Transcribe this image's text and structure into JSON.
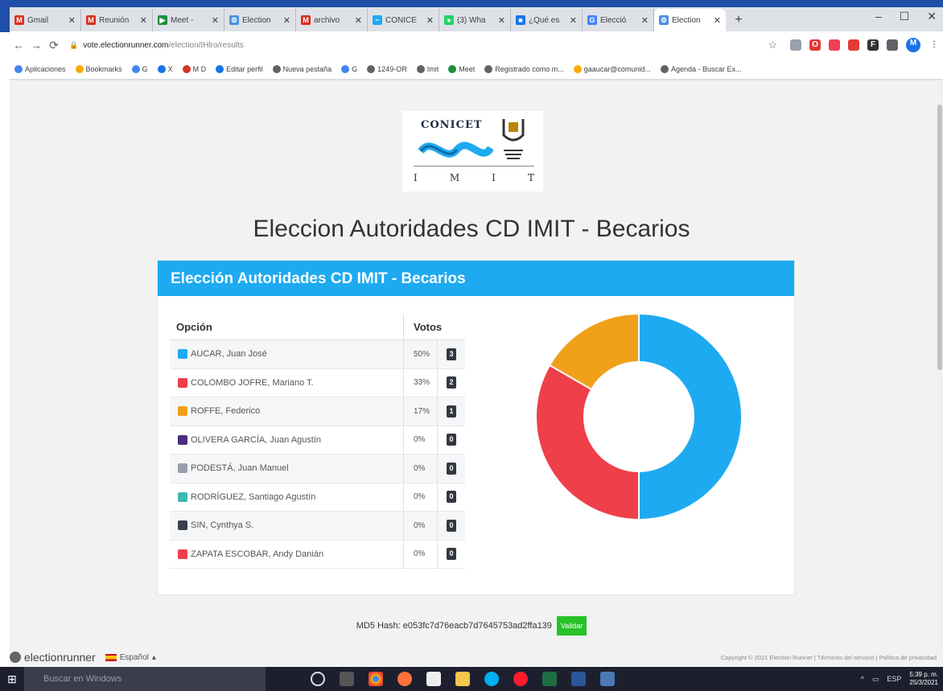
{
  "browser": {
    "tabs": [
      {
        "label": "Gmail",
        "color": "#d93025",
        "glyph": "M"
      },
      {
        "label": "Reunión",
        "color": "#d93025",
        "glyph": "M"
      },
      {
        "label": "Meet -",
        "color": "#1e8e3e",
        "glyph": "▶"
      },
      {
        "label": "Election",
        "color": "#4a90e2",
        "glyph": "⚙"
      },
      {
        "label": "archivo",
        "color": "#d93025",
        "glyph": "M"
      },
      {
        "label": "CONICE",
        "color": "#1eaaf1",
        "glyph": "~"
      },
      {
        "label": "(3) Wha",
        "color": "#25d366",
        "glyph": "●"
      },
      {
        "label": "¿Qué es",
        "color": "#1a73e8",
        "glyph": "■"
      },
      {
        "label": "Elecció",
        "color": "#4285f4",
        "glyph": "G"
      },
      {
        "label": "Election",
        "color": "#4a90e2",
        "glyph": "⚙"
      }
    ],
    "active_tab": 9,
    "url_host": "vote.electionrunner.com",
    "url_path": "/election/IHlro/results",
    "bookmarks": [
      "Aplicaciones",
      "Bookmarks",
      "G",
      "X",
      "M D",
      "Editar perfil",
      "Nueva pestaña",
      "G",
      "1249-OR",
      "Imit",
      "Meet",
      "Registrado como m...",
      "gaaucar@comunid...",
      "Agenda - Buscar Ex..."
    ]
  },
  "logo": {
    "top_text": "CONICET",
    "bottom_letters": [
      "I",
      "M",
      "I",
      "T"
    ]
  },
  "page_title": "Eleccion Autoridades CD IMIT - Becarios",
  "card": {
    "header": "Elección Autoridades CD IMIT - Becarios",
    "col_option": "Opción",
    "col_votes": "Votos",
    "rows": [
      {
        "name": "AUCAR, Juan José",
        "pct": "50%",
        "votes": "3",
        "color": "#1eaaf1"
      },
      {
        "name": "COLOMBO JOFRE, Mariano T.",
        "pct": "33%",
        "votes": "2",
        "color": "#ef3f4a"
      },
      {
        "name": "ROFFE, Federico",
        "pct": "17%",
        "votes": "1",
        "color": "#f0a019"
      },
      {
        "name": "OLIVERA GARCÍA, Juan Agustín",
        "pct": "0%",
        "votes": "0",
        "color": "#4b2d7f"
      },
      {
        "name": "PODESTÁ, Juan Manuel",
        "pct": "0%",
        "votes": "0",
        "color": "#9aa0ab"
      },
      {
        "name": "RODRÍGUEZ, Santiago Agustín",
        "pct": "0%",
        "votes": "0",
        "color": "#3fb8b0"
      },
      {
        "name": "SIN, Cynthya S.",
        "pct": "0%",
        "votes": "0",
        "color": "#3a3f4b"
      },
      {
        "name": "ZAPATA ESCOBAR, Andy Danián",
        "pct": "0%",
        "votes": "0",
        "color": "#ef3f4a"
      }
    ]
  },
  "chart_data": {
    "type": "pie",
    "categories": [
      "AUCAR, Juan José",
      "COLOMBO JOFRE, Mariano T.",
      "ROFFE, Federico",
      "OLIVERA GARCÍA, Juan Agustín",
      "PODESTÁ, Juan Manuel",
      "RODRÍGUEZ, Santiago Agustín",
      "SIN, Cynthya S.",
      "ZAPATA ESCOBAR, Andy Danián"
    ],
    "values": [
      3,
      2,
      1,
      0,
      0,
      0,
      0,
      0
    ],
    "colors": [
      "#1eaaf1",
      "#ef3f4a",
      "#f0a019",
      "#4b2d7f",
      "#9aa0ab",
      "#3fb8b0",
      "#3a3f4b",
      "#ef3f4a"
    ],
    "donut": true
  },
  "hash_text": "MD5 Hash: e053fc7d76eacb7d7645753ad2ffa139",
  "validate_label": "Validar",
  "footer": {
    "brand": "electionrunner",
    "language": "Español",
    "legal": "Copyright © 2021 Election Runner | Términos del servicio | Política de privacidad"
  },
  "taskbar": {
    "search_placeholder": "Buscar en Windows",
    "lang": "ESP",
    "time": "5:39 p. m.",
    "date": "25/3/2021"
  }
}
